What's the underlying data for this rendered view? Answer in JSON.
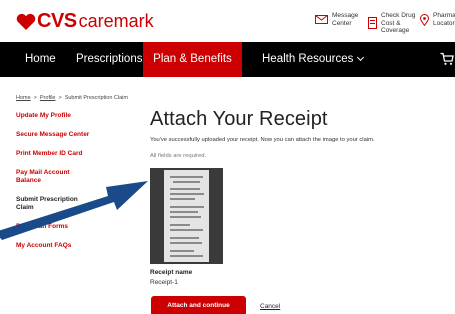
{
  "brand": {
    "cvs": "CVS",
    "caremark": "caremark",
    "accent": "#cc0000"
  },
  "utility": {
    "message_center": "Message Center",
    "check_drug": "Check Drug Cost & Coverage",
    "pharmacy_locator": "Pharmacy Locator"
  },
  "nav": {
    "home": "Home",
    "prescriptions": "Prescriptions",
    "plan_benefits": "Plan & Benefits",
    "health_resources": "Health Resources"
  },
  "breadcrumb": {
    "home": "Home",
    "profile": "Profile",
    "current": "Submit Prescription Claim"
  },
  "sidebar": {
    "items": [
      {
        "label": "Update My Profile"
      },
      {
        "label": "Secure Message Center"
      },
      {
        "label": "Print Member ID Card"
      },
      {
        "label": "Pay Mail Account Balance"
      },
      {
        "label": "Submit Prescription Claim"
      },
      {
        "label": "Print Plan Forms"
      },
      {
        "label": "My Account FAQs"
      }
    ]
  },
  "main": {
    "title": "Attach Your Receipt",
    "subtitle": "You've successfully uploaded your receipt. Now you can attach the image to your claim.",
    "required_note": "All fields are required.",
    "receipt_name_label": "Receipt name",
    "receipt_name_value": "Receipt-1",
    "attach_button": "Attach and continue",
    "cancel_link": "Cancel"
  },
  "overlay": {
    "arrow_color": "#1a4a8a"
  }
}
